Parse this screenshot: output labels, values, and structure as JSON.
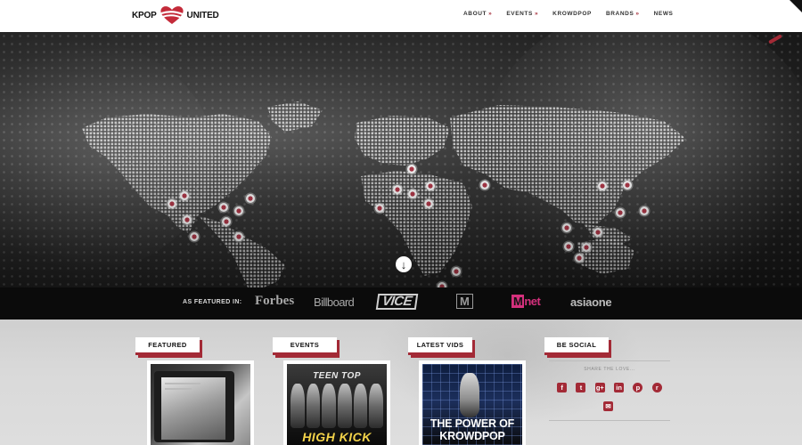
{
  "header": {
    "logo_left": "KPOP",
    "logo_right": "UNITED",
    "nav": [
      {
        "label": "ABOUT",
        "caret": "»"
      },
      {
        "label": "EVENTS",
        "caret": "»"
      },
      {
        "label": "KROWDPOP",
        "caret": ""
      },
      {
        "label": "BRANDS",
        "caret": "»"
      },
      {
        "label": "NEWS",
        "caret": ""
      }
    ]
  },
  "hero": {
    "scroll_icon": "arrow-down-circle-icon"
  },
  "featured_in": {
    "label": "AS FEATURED IN:",
    "brands": {
      "forbes": "Forbes",
      "billboard": "Billboard",
      "vice": "VICE",
      "mtv": "M",
      "mnet_m": "M",
      "mnet_rest": "net",
      "asiaone": "asiaone"
    }
  },
  "sections": {
    "featured": {
      "label": "FEATURED"
    },
    "events": {
      "label": "EVENTS",
      "card_title": "TEEN TOP",
      "card_big": "HIGH KICK"
    },
    "latest_vids": {
      "label": "LATEST VIDS",
      "card_text_1": "THE POWER OF",
      "card_text_2": "KROWDPOP"
    },
    "be_social": {
      "label": "BE SOCIAL",
      "share": "SHARE THE LOVE..."
    }
  },
  "social_icons": [
    {
      "name": "facebook-icon",
      "glyph": "f"
    },
    {
      "name": "twitter-icon",
      "glyph": "t"
    },
    {
      "name": "google-plus-icon",
      "glyph": "g+"
    },
    {
      "name": "linkedin-icon",
      "glyph": "in"
    },
    {
      "name": "pinterest-icon",
      "glyph": "p"
    },
    {
      "name": "reddit-icon",
      "glyph": "r"
    }
  ],
  "mail_icon": {
    "name": "email-icon",
    "glyph": "✉"
  },
  "colors": {
    "accent": "#a32a36",
    "bar": "#0b0b0b",
    "background": "#d6d6d6"
  }
}
